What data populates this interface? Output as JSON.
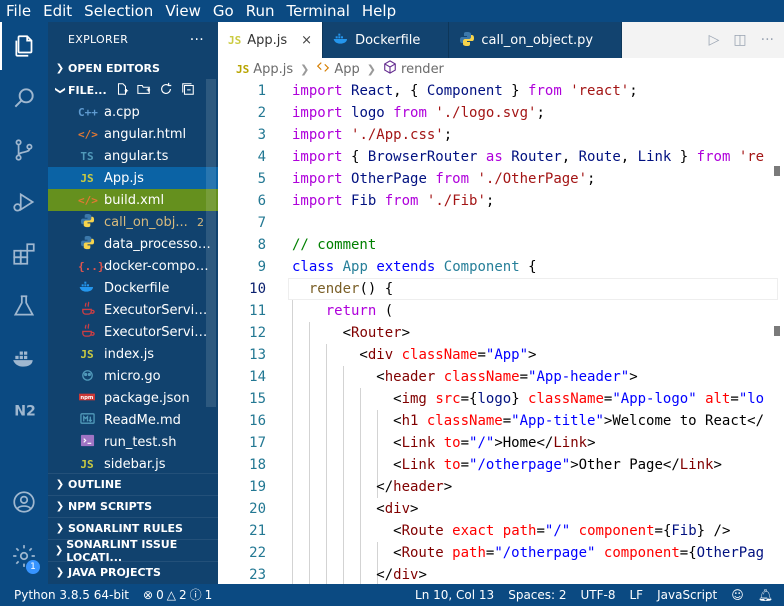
{
  "menubar": {
    "items": [
      "File",
      "Edit",
      "Selection",
      "View",
      "Go",
      "Run",
      "Terminal",
      "Help"
    ]
  },
  "activitybar": {
    "icons": [
      "explorer-icon",
      "search-icon",
      "source-control-icon",
      "run-debug-icon",
      "extensions-icon",
      "testing-flask-icon",
      "docker-icon",
      "n2-icon",
      "account-icon",
      "settings-gear-icon"
    ],
    "settings_badge": "1"
  },
  "sidebar": {
    "title": "EXPLORER",
    "more": "···",
    "open_editors": "OPEN EDITORS",
    "files_header": "FILE...",
    "files": [
      {
        "icon": "C++",
        "name": "a.cpp",
        "color": "#5f9bd1"
      },
      {
        "icon": "</>",
        "name": "angular.html",
        "color": "#e37933"
      },
      {
        "icon": "TS",
        "name": "angular.ts",
        "color": "#519aba"
      },
      {
        "icon": "JS",
        "name": "App.js",
        "color": "#cbcb41",
        "state": "selected"
      },
      {
        "icon": "</>",
        "name": "build.xml",
        "color": "#e37933",
        "state": "highlight"
      },
      {
        "icon": "py",
        "name": "call_on_obj...",
        "color": "#3c78aa",
        "badge": "2",
        "modified": true
      },
      {
        "icon": "py",
        "name": "data_processor.py",
        "color": "#3c78aa"
      },
      {
        "icon": "{..}",
        "name": "docker-compose...",
        "color": "#e0554e"
      },
      {
        "icon": "whale",
        "name": "Dockerfile",
        "color": "#2496ed"
      },
      {
        "icon": "java",
        "name": "ExecutorService...",
        "color": "#cc3e44"
      },
      {
        "icon": "java",
        "name": "ExecutorService...",
        "color": "#cc3e44"
      },
      {
        "icon": "JS",
        "name": "index.js",
        "color": "#cbcb41"
      },
      {
        "icon": "go",
        "name": "micro.go",
        "color": "#519aba"
      },
      {
        "icon": "npm",
        "name": "package.json",
        "color": "#cb3837"
      },
      {
        "icon": "md",
        "name": "ReadMe.md",
        "color": "#519aba"
      },
      {
        "icon": ">_",
        "name": "run_test.sh",
        "color": "#a074c4"
      },
      {
        "icon": "JS",
        "name": "sidebar.js",
        "color": "#cbcb41"
      }
    ],
    "bottom_sections": [
      "OUTLINE",
      "NPM SCRIPTS",
      "SONARLINT RULES",
      "SONARLINT ISSUE LOCATI...",
      "JAVA PROJECTS"
    ]
  },
  "tabs": [
    {
      "icon": "JS",
      "label": "App.js",
      "active": true,
      "close": "×"
    },
    {
      "icon": "whale",
      "label": "Dockerfile"
    },
    {
      "icon": "py",
      "label": "call_on_object.py"
    }
  ],
  "breadcrumb": {
    "file_icon": "JS",
    "file": "App.js",
    "class": "App",
    "method": "render"
  },
  "editor": {
    "current_line": 10,
    "lines": [
      {
        "n": "1",
        "html": "<span class='ctrl'>import</span> <span class='var'>React</span>, { <span class='var'>Component</span> } <span class='ctrl'>from</span> <span class='str'>'react'</span>;"
      },
      {
        "n": "2",
        "html": "<span class='ctrl'>import</span> <span class='var'>logo</span> <span class='ctrl'>from</span> <span class='str'>'./logo.svg'</span>;"
      },
      {
        "n": "3",
        "html": "<span class='ctrl'>import</span> <span class='str'>'./App.css'</span>;"
      },
      {
        "n": "4",
        "html": "<span class='ctrl'>import</span> { <span class='var'>BrowserRouter</span> <span class='ctrl'>as</span> <span class='var'>Router</span>, <span class='var'>Route</span>, <span class='var'>Link</span> } <span class='ctrl'>from</span> <span class='str'>'re</span>"
      },
      {
        "n": "5",
        "html": "<span class='ctrl'>import</span> <span class='var'>OtherPage</span> <span class='ctrl'>from</span> <span class='str'>'./OtherPage'</span>;"
      },
      {
        "n": "6",
        "html": "<span class='ctrl'>import</span> <span class='var'>Fib</span> <span class='ctrl'>from</span> <span class='str'>'./Fib'</span>;"
      },
      {
        "n": "7",
        "html": ""
      },
      {
        "n": "8",
        "html": "<span class='cmt'>// comment</span>"
      },
      {
        "n": "9",
        "html": "<span class='kw'>class</span> <span class='cls'>App</span> <span class='kw'>extends</span> <span class='cls'>Component</span> {"
      },
      {
        "n": "10",
        "html": "  <span class='fn'>render</span>() {"
      },
      {
        "n": "11",
        "html": "    <span class='ctrl'>return</span> ("
      },
      {
        "n": "12",
        "html": "      &lt;<span class='tag'>Router</span>&gt;"
      },
      {
        "n": "13",
        "html": "        &lt;<span class='tag'>div</span> <span class='attr'>className</span>=<span class='attrv'>\"App\"</span>&gt;"
      },
      {
        "n": "14",
        "html": "          &lt;<span class='tag'>header</span> <span class='attr'>className</span>=<span class='attrv'>\"App-header\"</span>&gt;"
      },
      {
        "n": "15",
        "html": "            &lt;<span class='tag'>img</span> <span class='attr'>src</span>={<span class='var'>logo</span>} <span class='attr'>className</span>=<span class='attrv'>\"App-logo\"</span> <span class='attr'>alt</span>=<span class='attrv'>\"lo</span>"
      },
      {
        "n": "16",
        "html": "            &lt;<span class='tag'>h1</span> <span class='attr'>className</span>=<span class='attrv'>\"App-title\"</span>&gt;Welcome to React&lt;/"
      },
      {
        "n": "17",
        "html": "            &lt;<span class='tag'>Link</span> <span class='attr'>to</span>=<span class='attrv'>\"/\"</span>&gt;Home&lt;/<span class='tag'>Link</span>&gt;"
      },
      {
        "n": "18",
        "html": "            &lt;<span class='tag'>Link</span> <span class='attr'>to</span>=<span class='attrv'>\"/otherpage\"</span>&gt;Other Page&lt;/<span class='tag'>Link</span>&gt;"
      },
      {
        "n": "19",
        "html": "          &lt;/<span class='tag'>header</span>&gt;"
      },
      {
        "n": "20",
        "html": "          &lt;<span class='tag'>div</span>&gt;"
      },
      {
        "n": "21",
        "html": "            &lt;<span class='tag'>Route</span> <span class='attr'>exact</span> <span class='attr'>path</span>=<span class='attrv'>\"/\"</span> <span class='attr'>component</span>={<span class='var'>Fib</span>} /&gt;"
      },
      {
        "n": "22",
        "html": "            &lt;<span class='tag'>Route</span> <span class='attr'>path</span>=<span class='attrv'>\"/otherpage\"</span> <span class='attr'>component</span>={<span class='var'>OtherPag</span>"
      },
      {
        "n": "23",
        "html": "          &lt;/<span class='tag'>div</span>&gt;"
      }
    ]
  },
  "statusbar": {
    "python": "Python 3.8.5 64-bit",
    "errors": "0",
    "warnings": "2",
    "info": "1",
    "position": "Ln 10, Col 13",
    "spaces": "Spaces: 2",
    "encoding": "UTF-8",
    "eol": "LF",
    "language": "JavaScript"
  },
  "colors": {
    "accent": "#0b4a82",
    "sidebar": "#11426e",
    "selected": "#0b63a5",
    "highlight": "#65901e"
  }
}
